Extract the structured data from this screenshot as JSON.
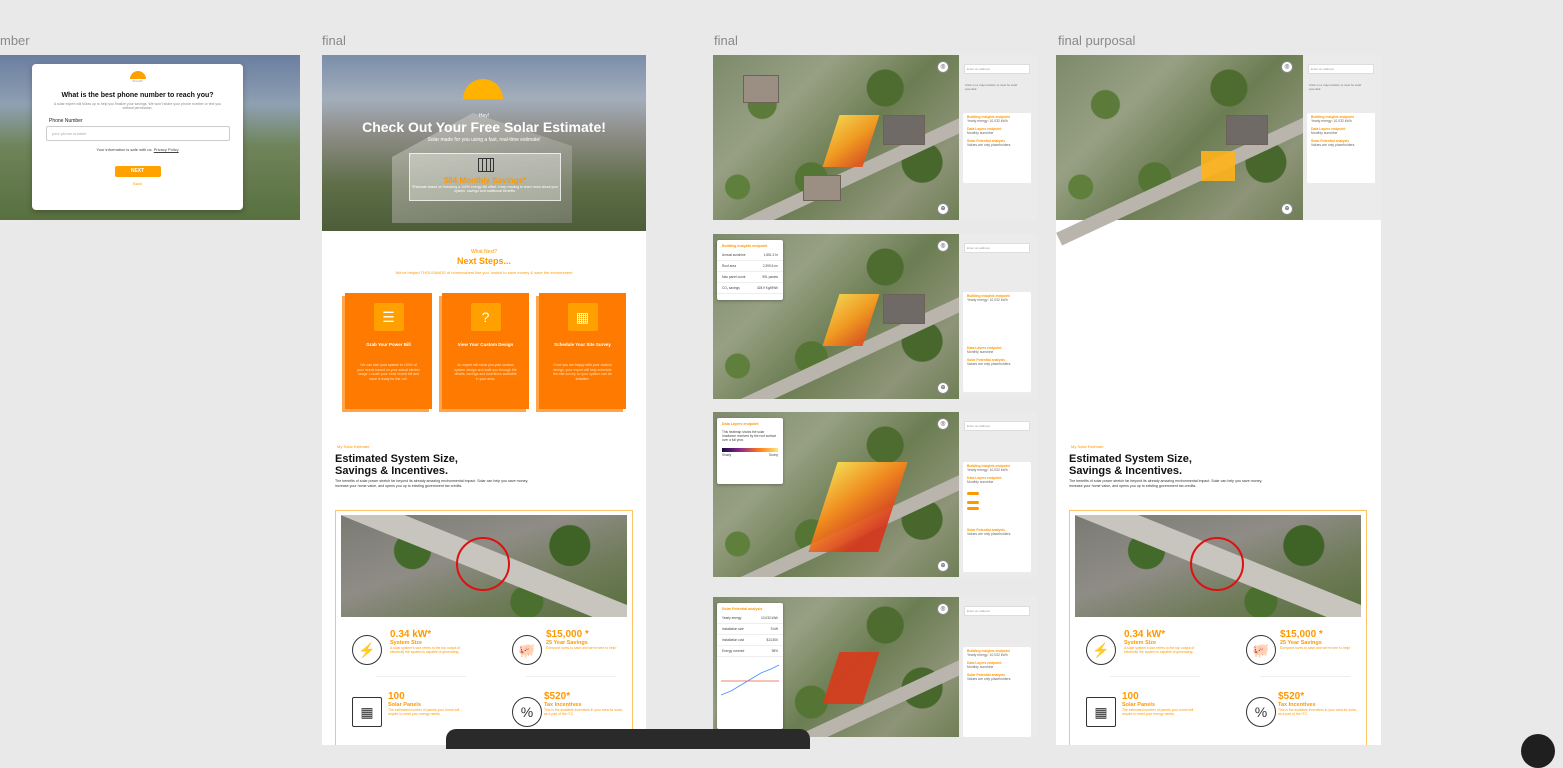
{
  "frames": {
    "a": {
      "label": "mber"
    },
    "b": {
      "label": "final"
    },
    "c": {
      "label": "final"
    },
    "d": {
      "label": "final purposal"
    }
  },
  "phone_modal": {
    "logo_text": "SOLAR",
    "title": "What is the best phone number to reach you?",
    "subtitle": "A solar expert will follow up to help you finalize your savings. We won't share your phone number or text you without permission.",
    "field_label": "Phone Number",
    "placeholder": "your phone number",
    "privacy_text": "Your information is safe with us.",
    "privacy_link": "Privacy Policy",
    "next_button": "NEXT",
    "back_link": "Back"
  },
  "landing": {
    "hero": {
      "hey": "Hey!",
      "title": "Check Out Your Free Solar Estimate!",
      "tagline": "Solar made for you using a fast, real-time estimate!",
      "amount": "$84",
      "amount_label": "Monthly Savings*",
      "footnote": "*Estimate based on financing a 100% energy bill offset. Keep reading to learn more about your system, savings and additional benefits."
    },
    "next": {
      "eyebrow": "What Next?",
      "title": "Next Steps...",
      "subtitle": "We've helped THOUSANDS of homeowners like you, switch to save money & save the environment"
    },
    "steps": [
      {
        "title": "Grab Your Power Bill",
        "icon": "chat-icon",
        "glyph": "☰",
        "text": "We can size your system to 100% of your needs based on your actual electric usage. Locate your most recent bill and have it ready for the call."
      },
      {
        "title": "View Your Custom Design",
        "icon": "question-icon",
        "glyph": "?",
        "text": "An expert will show you your custom system design and walk you through the details, savings and incentives available in your area."
      },
      {
        "title": "Schedule Your Site Survey",
        "icon": "calendar-icon",
        "glyph": "▦",
        "text": "Once you are happy with your custom design, your expert will help schedule the site survey so your system can be installed."
      }
    ],
    "estimate": {
      "eyebrow": "My Solar Estimate",
      "title_line1": "Estimated System Size,",
      "title_line2": "Savings & Incentives.",
      "description": "The benefits of solar power stretch far beyond its already amazing environmental impact. Solar can help you save money, increase your home value, and opens you up to existing government tax credits.",
      "stats": [
        {
          "value": "0.34 kW*",
          "label": "System Size",
          "text": "A solar system's size refers to the top output of electricity the system is capable of generating.",
          "icon": "lightning-icon",
          "glyph": "⚡"
        },
        {
          "value": "$15,000 *",
          "label": "25 Year Savings",
          "text": "Everyone loves to save and we're here to help!",
          "icon": "piggy-bank-icon",
          "glyph": "🐖"
        },
        {
          "value": "100",
          "label": "Solar Panels",
          "text": "The estimated number of panels your home will require to meet your energy needs.",
          "icon": "solar-panel-icon",
          "glyph": "▦"
        },
        {
          "value": "$520*",
          "label": "Tax Incentives",
          "text": "This is the available incentives in your area for solar, as a part of the ITC.",
          "icon": "percent-icon",
          "glyph": "%"
        }
      ]
    }
  },
  "sidebar": {
    "search_placeholder": "Enter an address",
    "intro": "Click on a map location to view its solar potential.",
    "items": [
      {
        "title": "Building insights endpoint",
        "sub": "Yearly energy: 10,032 kWh"
      },
      {
        "title": "Data Layers endpoint",
        "sub": "Monthly sunshine"
      },
      {
        "title": "Solar Potential analysis",
        "sub": "Values are only placeholders."
      }
    ]
  },
  "info_panels": {
    "insights": {
      "title": "Building insights endpoint",
      "rows": [
        {
          "k": "Annual sunshine",
          "v": "1,851.3 hr"
        },
        {
          "k": "Roof area",
          "v": "2,399.6 m²"
        },
        {
          "k": "Max panel count",
          "v": "991 panels"
        },
        {
          "k": "CO₂ savings",
          "v": "428.9 Kg/MWh"
        }
      ]
    },
    "layers": {
      "title": "Data Layers endpoint",
      "text": "This heatmap shows the solar irradiance received by the roof surface over a full year.",
      "legend_low": "Shady",
      "legend_high": "Sunny"
    },
    "potential": {
      "title": "Solar Potential analysis",
      "rows": [
        {
          "k": "Yearly energy",
          "v": "10,032 kWh"
        },
        {
          "k": "Installation size",
          "v": "5 kW"
        },
        {
          "k": "Installation cost",
          "v": "$13,500"
        },
        {
          "k": "Energy covered",
          "v": "98%"
        }
      ]
    }
  },
  "colors": {
    "accent": "#ff9800",
    "step_card": "#ff7a00",
    "canvas": "#e9e9e9"
  }
}
